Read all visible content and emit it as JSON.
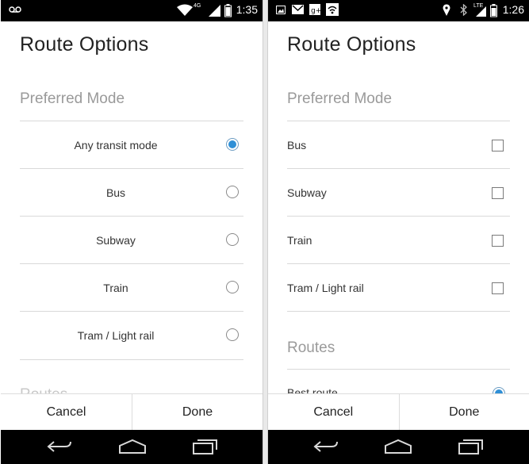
{
  "screens": [
    {
      "status": {
        "time": "1:35",
        "network_label": "4G"
      },
      "title": "Route Options",
      "preferred_mode_header": "Preferred Mode",
      "modes": [
        {
          "label": "Any transit mode",
          "selected": true
        },
        {
          "label": "Bus",
          "selected": false
        },
        {
          "label": "Subway",
          "selected": false
        },
        {
          "label": "Train",
          "selected": false
        },
        {
          "label": "Tram / Light rail",
          "selected": false
        }
      ],
      "routes_header": "Routes",
      "cancel_label": "Cancel",
      "done_label": "Done"
    },
    {
      "status": {
        "time": "1:26",
        "network_label": "LTE"
      },
      "title": "Route Options",
      "preferred_mode_header": "Preferred Mode",
      "modes": [
        {
          "label": "Bus",
          "checked": false
        },
        {
          "label": "Subway",
          "checked": false
        },
        {
          "label": "Train",
          "checked": false
        },
        {
          "label": "Tram / Light rail",
          "checked": false
        }
      ],
      "routes_header": "Routes",
      "route_options": [
        {
          "label": "Best route",
          "selected": true
        }
      ],
      "cancel_label": "Cancel",
      "done_label": "Done"
    }
  ],
  "colors": {
    "accent": "#2f8fd6",
    "divider": "#d9d9d9",
    "header_gray": "#9a9a9a"
  }
}
